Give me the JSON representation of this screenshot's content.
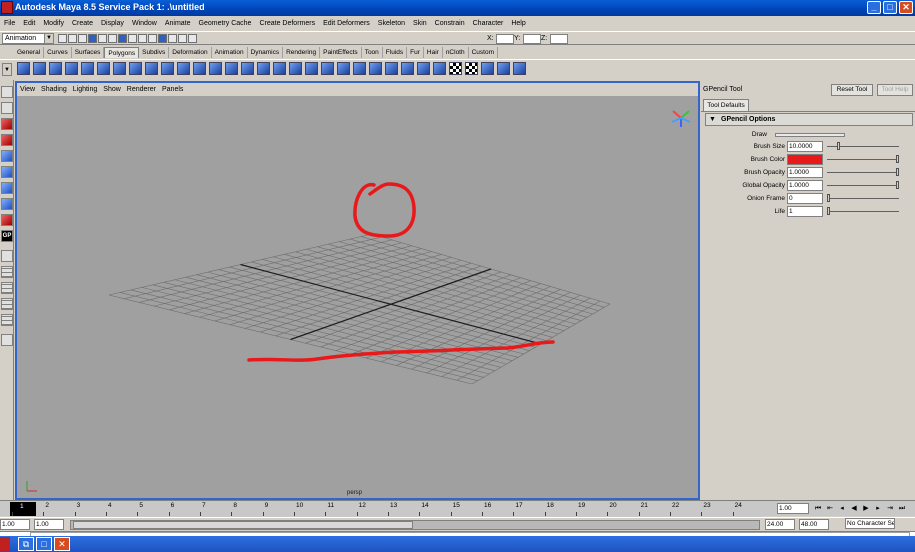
{
  "window": {
    "title": "Autodesk Maya 8.5 Service Pack 1: .\\untitled",
    "minimize": "_",
    "maximize": "□",
    "close": "✕"
  },
  "menu": [
    "File",
    "Edit",
    "Modify",
    "Create",
    "Display",
    "Window",
    "Animate",
    "Geometry Cache",
    "Create Deformers",
    "Edit Deformers",
    "Skeleton",
    "Skin",
    "Constrain",
    "Character",
    "Help"
  ],
  "status": {
    "mode": "Animation",
    "x_label": "X:",
    "y_label": "Y:",
    "z_label": "Z:"
  },
  "shelf_tabs": [
    "General",
    "Curves",
    "Surfaces",
    "Polygons",
    "Subdivs",
    "Deformation",
    "Animation",
    "Dynamics",
    "Rendering",
    "PaintEffects",
    "Toon",
    "Fluids",
    "Fur",
    "Hair",
    "nCloth",
    "Custom"
  ],
  "active_shelf": "Polygons",
  "viewport": {
    "menu": [
      "View",
      "Shading",
      "Lighting",
      "Show",
      "Renderer",
      "Panels"
    ],
    "camera": "persp",
    "stroke_color": "#e8191b",
    "grid_color": "#6e6e6e",
    "axis_color": "#1e1e1e",
    "background": "#a0a0a0"
  },
  "attribute_editor": {
    "tool_name": "GPencil Tool",
    "reset_tool": "Reset Tool",
    "tool_help": "Tool Help",
    "tab": "Tool Defaults",
    "section": "GPencil Options",
    "rows": [
      {
        "label": "Draw"
      },
      {
        "label": "Brush Size",
        "value": "10.0000"
      },
      {
        "label": "Brush Color",
        "color": "#e8191b"
      },
      {
        "label": "Brush Opacity",
        "value": "1.0000"
      },
      {
        "label": "Global Opacity",
        "value": "1.0000"
      },
      {
        "label": "Onion Frame",
        "value": "0"
      },
      {
        "label": "Life",
        "value": "1"
      }
    ]
  },
  "timeline": {
    "ticks": [
      "1",
      "2",
      "3",
      "4",
      "5",
      "6",
      "7",
      "8",
      "9",
      "10",
      "11",
      "12",
      "13",
      "14",
      "15",
      "16",
      "17",
      "18",
      "19",
      "20",
      "21",
      "22",
      "23",
      "24"
    ],
    "current_frame": "1.00",
    "range_start": "1.00",
    "playback_start": "1.00",
    "playback_end": "24.00",
    "range_end": "48.00",
    "character_set": "No Character Set"
  }
}
